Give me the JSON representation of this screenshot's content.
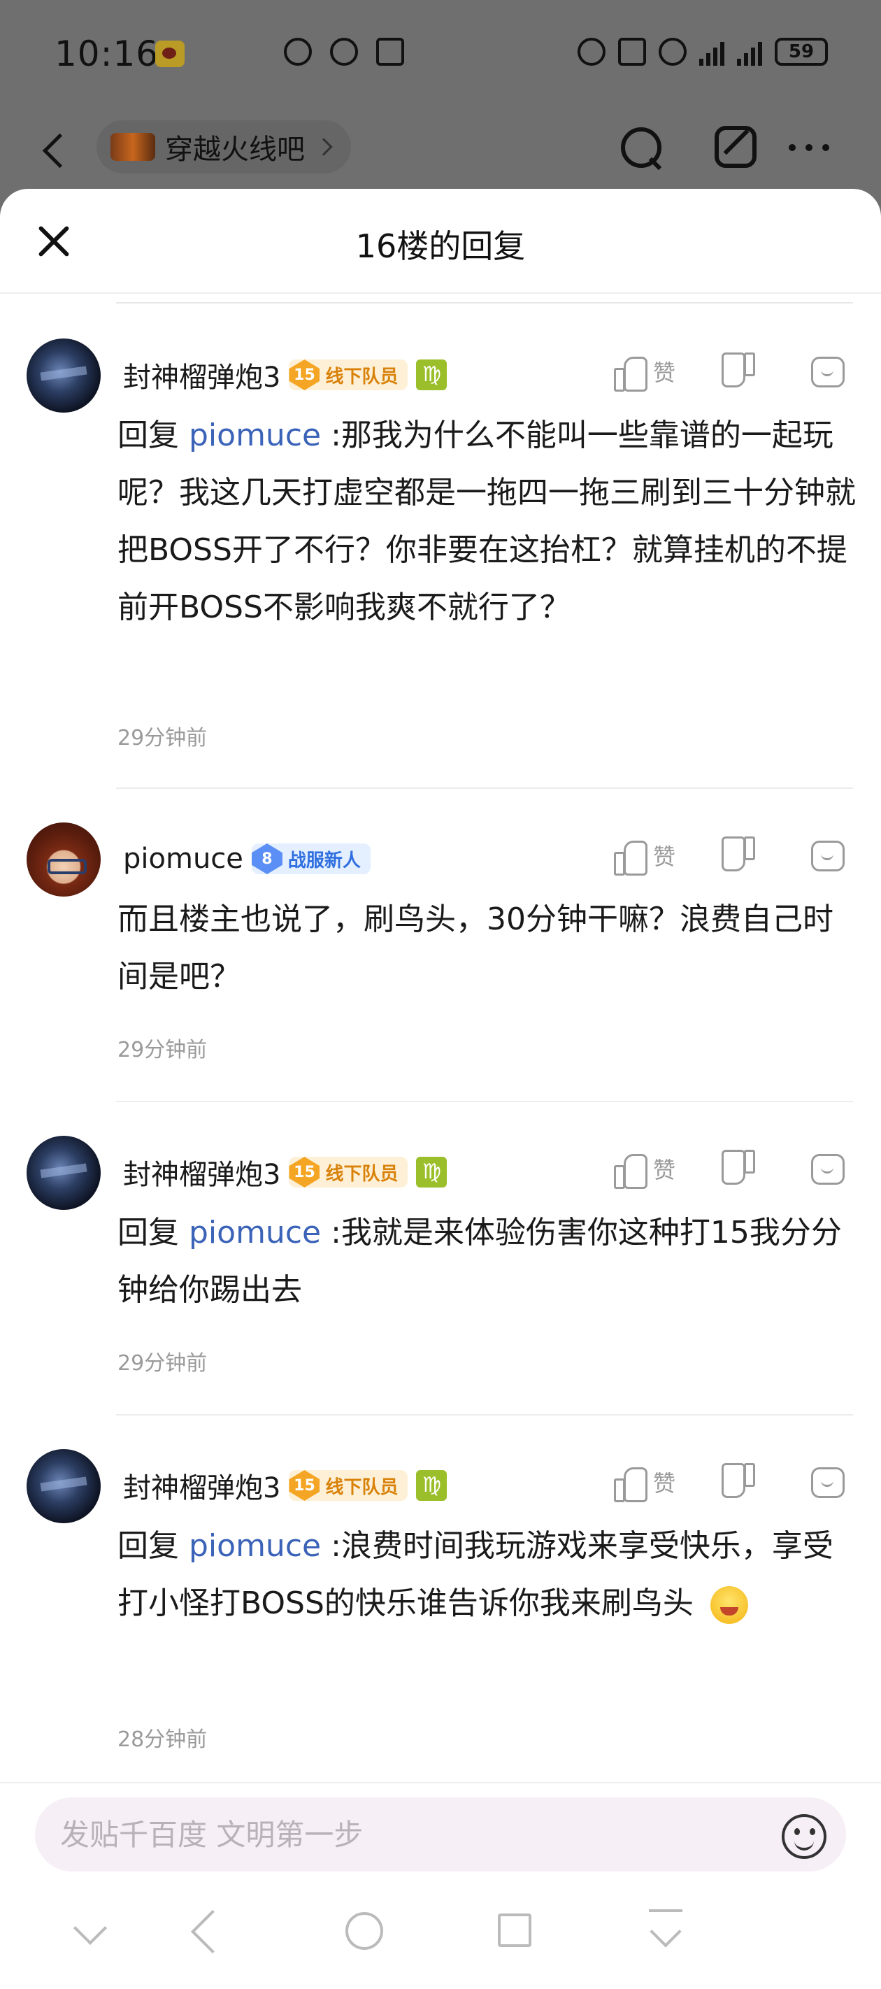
{
  "status_bar": {
    "time": "10:16",
    "battery": "59"
  },
  "top_bar": {
    "forum_name": "穿越火线吧"
  },
  "sheet": {
    "title": "16楼的回复"
  },
  "actions": {
    "like_label": "赞"
  },
  "comments": [
    {
      "username": "封神榴弹炮3",
      "level": "15",
      "title": "线下队员",
      "zodiac": "♍",
      "reply_prefix": "回复",
      "mention": "piomuce",
      "text": ":那我为什么不能叫一些靠谱的一起玩呢？我这几天打虚空都是一拖四一拖三刷到三十分钟就把BOSS开了不行？你非要在这抬杠？就算挂机的不提前开BOSS不影响我爽不就行了？",
      "time": "29分钟前"
    },
    {
      "username": "piomuce",
      "level": "8",
      "title": "战服新人",
      "text": "而且楼主也说了，刷鸟头，30分钟干嘛？浪费自己时间是吧？",
      "time": "29分钟前"
    },
    {
      "username": "封神榴弹炮3",
      "level": "15",
      "title": "线下队员",
      "zodiac": "♍",
      "reply_prefix": "回复",
      "mention": "piomuce",
      "text": ":我就是来体验伤害你这种打15我分分钟给你踢出去",
      "time": "29分钟前"
    },
    {
      "username": "封神榴弹炮3",
      "level": "15",
      "title": "线下队员",
      "zodiac": "♍",
      "reply_prefix": "回复",
      "mention": "piomuce",
      "text": ":浪费时间我玩游戏来享受快乐，享受打小怪打BOSS的快乐谁告诉你我来刷鸟头",
      "time": "28分钟前"
    }
  ],
  "composer": {
    "placeholder": "发贴千百度 文明第一步"
  }
}
